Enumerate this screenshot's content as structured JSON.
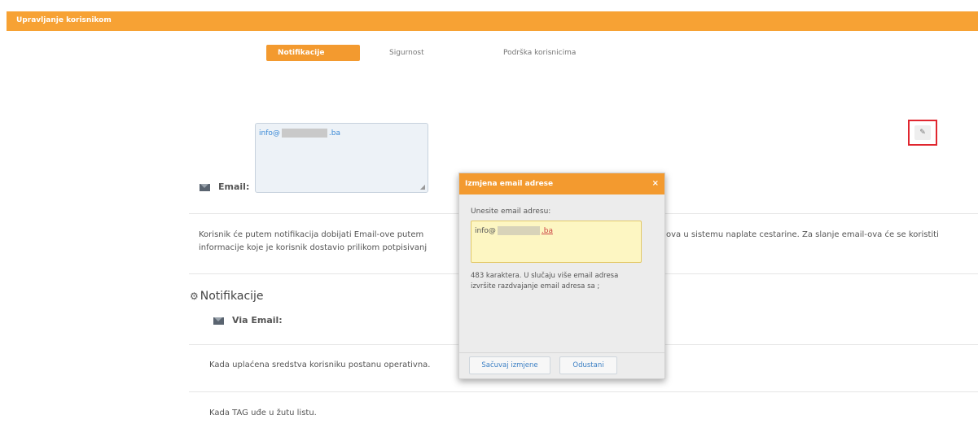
{
  "header": {
    "title": "Upravljanje korisnikom"
  },
  "tabs": [
    {
      "label": "Notifikacije",
      "active": true
    },
    {
      "label": "Sigurnost",
      "active": false
    },
    {
      "label": "Podrška korisnicima",
      "active": false
    }
  ],
  "email_field": {
    "value_prefix": "info@",
    "value_suffix": ".ba",
    "label": "Email:"
  },
  "description": {
    "line1_start": "Korisnik će putem notifikacija dobijati Email-ove putem",
    "line1_end": "ova u sistemu naplate cestarine. Za slanje email-ova će se koristiti",
    "line2": "informacije koje je korisnik dostavio prilikom potpisivanj"
  },
  "notifications": {
    "title": "Notifikacije",
    "via_email": "Via Email:",
    "rows": [
      "Kada uplaćena sredstva korisniku postanu operativna.",
      "Kada TAG uđe u žutu listu."
    ]
  },
  "modal": {
    "title": "Izmjena email adrese",
    "close": "×",
    "label": "Unesite email adresu:",
    "value_prefix": "info@",
    "value_suffix": ".ba",
    "hint": "483 karaktera. U slučaju više email adresa izvršite razdvajanje email adresa sa ;",
    "save_button": "Sačuvaj izmjene",
    "cancel_button": "Odustani"
  },
  "colors": {
    "accent": "#f39a2f",
    "highlight_border": "#e0262f",
    "link": "#3b8ad6"
  }
}
